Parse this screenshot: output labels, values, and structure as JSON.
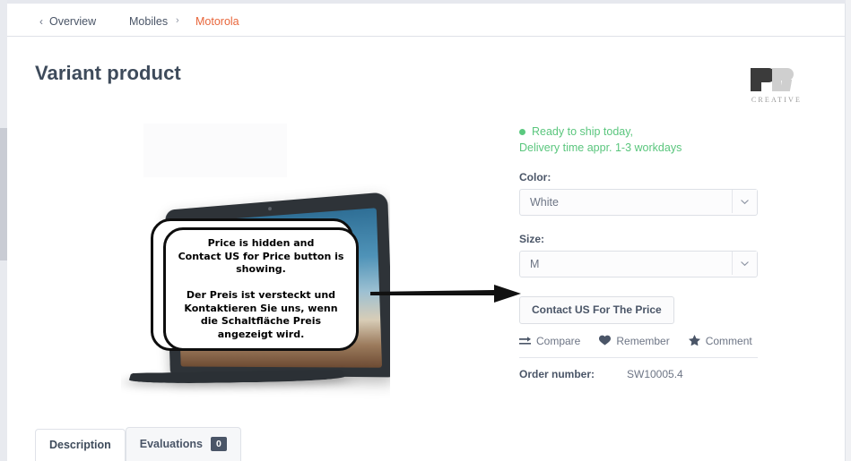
{
  "breadcrumb": {
    "back_label": "Overview",
    "back_icon": "chevron-left-icon",
    "category": "Mobiles",
    "separator": "›",
    "current": "Motorola",
    "current_color": "#e8663b"
  },
  "page_title": "Variant product",
  "logo": {
    "mark": "PR",
    "caption": "CREATIVE"
  },
  "product_image": {
    "alt": "laptop product photo"
  },
  "annotation": {
    "text": "Price is hidden and\nContact US for Price button is\nshowing.\n\nDer Preis ist versteckt und\nKontaktieren Sie uns, wenn\ndie Schaltfläche Preis\nangezeigt wird.",
    "arrow": "arrow-right"
  },
  "availability": {
    "status": "Ready to ship today,",
    "delivery": "Delivery time appr. 1-3 workdays",
    "status_color": "#5ac67d",
    "dot_icon": "status-dot-icon"
  },
  "options": [
    {
      "label": "Color:",
      "value": "White",
      "icon": "chevron-down-icon"
    },
    {
      "label": "Size:",
      "value": "M",
      "icon": "chevron-down-icon"
    }
  ],
  "cta": {
    "label": "Contact US For The Price"
  },
  "actions": [
    {
      "label": "Compare",
      "icon": "compare-icon"
    },
    {
      "label": "Remember",
      "icon": "heart-icon"
    },
    {
      "label": "Comment",
      "icon": "star-icon"
    }
  ],
  "order": {
    "label": "Order number:",
    "value": "SW10005.4"
  },
  "tabs": [
    {
      "label": "Description",
      "active": true,
      "badge": null
    },
    {
      "label": "Evaluations",
      "active": false,
      "badge": "0"
    }
  ]
}
